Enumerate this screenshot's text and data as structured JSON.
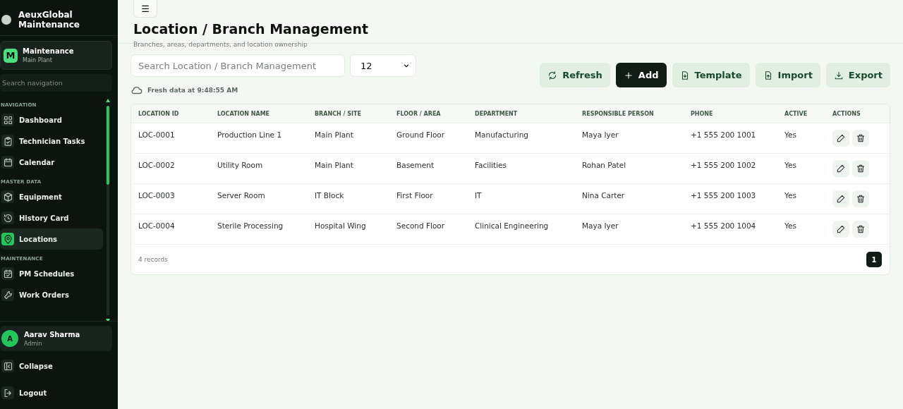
{
  "sidebar": {
    "brand": "AeuxGlobal Maintenance",
    "workspace": {
      "initial": "M",
      "name": "Maintenance",
      "site": "Main Plant"
    },
    "search": {
      "placeholder": "Search navigation"
    },
    "sections": [
      {
        "heading": "NAVIGATION",
        "items": [
          {
            "label": "Dashboard",
            "selected": false
          },
          {
            "label": "Technician Tasks",
            "selected": false
          },
          {
            "label": "Calendar",
            "selected": false
          }
        ]
      },
      {
        "heading": "MASTER DATA",
        "items": [
          {
            "label": "Equipment",
            "selected": false
          },
          {
            "label": "History Card",
            "selected": false
          },
          {
            "label": "Locations",
            "selected": true
          }
        ]
      },
      {
        "heading": "MAINTENANCE",
        "items": [
          {
            "label": "PM Schedules",
            "selected": false
          },
          {
            "label": "Work Orders",
            "selected": false
          }
        ]
      }
    ],
    "user": {
      "initial": "A",
      "name": "Aarav Sharma",
      "role": "Admin"
    },
    "footer": [
      "Collapse",
      "Logout"
    ]
  },
  "header": {
    "menu_glyph": "☰",
    "title": "Location / Branch Management",
    "subtitle": "Branches, areas, departments, and location ownership"
  },
  "toolbar": {
    "search": {
      "placeholder": "Search Location / Branch Management"
    },
    "page_size": "12",
    "freshness": "Fresh data at 9:48:55 AM",
    "buttons": [
      {
        "label": "Refresh",
        "kind": "refresh"
      },
      {
        "label": "Add",
        "kind": "add"
      },
      {
        "label": "Template",
        "kind": "template"
      },
      {
        "label": "Import",
        "kind": "import"
      },
      {
        "label": "Export",
        "kind": "export"
      }
    ]
  },
  "table": {
    "columns": [
      "LOCATION ID",
      "LOCATION NAME",
      "BRANCH / SITE",
      "FLOOR / AREA",
      "DEPARTMENT",
      "RESPONSIBLE PERSON",
      "PHONE",
      "ACTIVE",
      "ACTIONS"
    ],
    "rows": [
      [
        "LOC-0001",
        "Production Line 1",
        "Main Plant",
        "Ground Floor",
        "Manufacturing",
        "Maya Iyer",
        "+1 555 200 1001",
        "Yes"
      ],
      [
        "LOC-0002",
        "Utility Room",
        "Main Plant",
        "Basement",
        "Facilities",
        "Rohan Patel",
        "+1 555 200 1002",
        "Yes"
      ],
      [
        "LOC-0003",
        "Server Room",
        "IT Block",
        "First Floor",
        "IT",
        "Nina Carter",
        "+1 555 200 1003",
        "Yes"
      ],
      [
        "LOC-0004",
        "Sterile Processing",
        "Hospital Wing",
        "Second Floor",
        "Clinical Engineering",
        "Maya Iyer",
        "+1 555 200 1004",
        "Yes"
      ]
    ],
    "record_count": "4 records",
    "pages": [
      {
        "label": "1",
        "selected": true
      }
    ]
  }
}
